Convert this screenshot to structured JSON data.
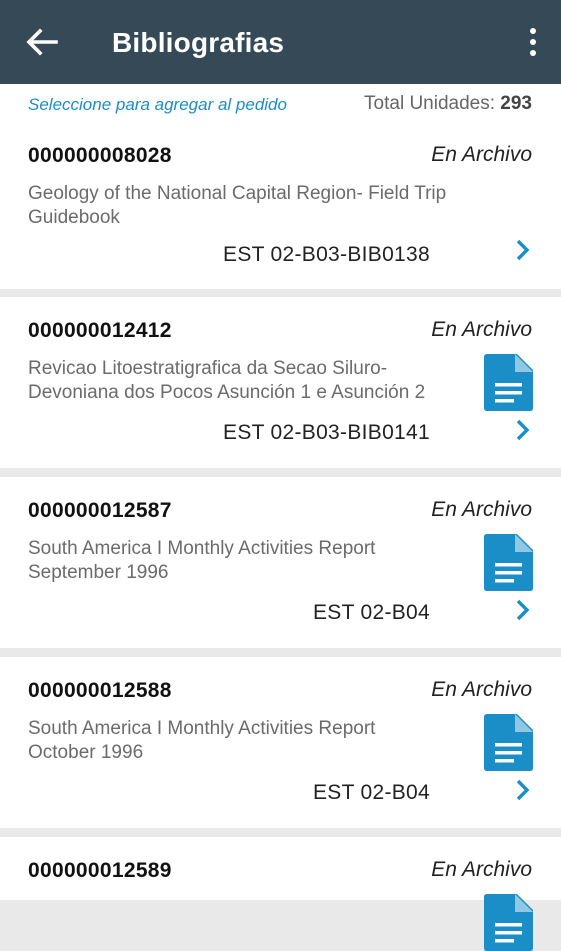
{
  "header": {
    "title": "Bibliografias",
    "back_icon": "arrow-back-icon",
    "menu_icon": "more-vert-icon"
  },
  "subheader": {
    "hint": "Seleccione para agregar al pedido",
    "total_label": "Total Unidades:",
    "total_value": "293"
  },
  "colors": {
    "appbar": "#354a56",
    "accent": "#1b8ec7",
    "background": "#e9e9e9"
  },
  "items": [
    {
      "code": "000000008028",
      "status": "En Archivo",
      "desc_line1": "Geology of the National Capital Region- Field Trip",
      "desc_line2": "Guidebook",
      "location": "EST 02-B03-BIB0138",
      "has_document": false
    },
    {
      "code": "000000012412",
      "status": "En Archivo",
      "desc_line1": "Revicao Litoestratigrafica da Secao Siluro-",
      "desc_line2": "Devoniana dos Pocos Asunción 1 e Asunción 2",
      "location": "EST 02-B03-BIB0141",
      "has_document": true
    },
    {
      "code": "000000012587",
      "status": "En Archivo",
      "desc_line1": "South America I Monthly Activities Report",
      "desc_line2": "September 1996",
      "location": "EST 02-B04",
      "has_document": true
    },
    {
      "code": "000000012588",
      "status": "En Archivo",
      "desc_line1": "South America I Monthly Activities Report",
      "desc_line2": "October 1996",
      "location": "EST 02-B04",
      "has_document": true
    },
    {
      "code": "000000012589",
      "status": "En Archivo",
      "has_document": true
    }
  ]
}
